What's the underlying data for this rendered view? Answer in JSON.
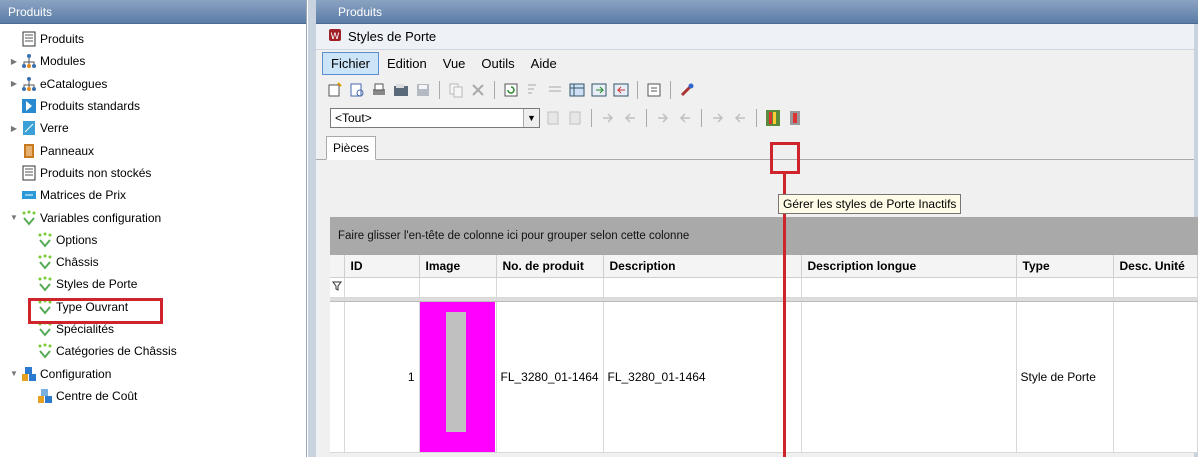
{
  "left_panel": {
    "title": "Produits",
    "tree": [
      {
        "label": "Produits",
        "icon": "document-list-icon",
        "level": 0,
        "arrow": ""
      },
      {
        "label": "Modules",
        "icon": "module-tree-icon",
        "level": 0,
        "arrow": "▶"
      },
      {
        "label": "eCatalogues",
        "icon": "module-tree-icon",
        "level": 0,
        "arrow": "▶"
      },
      {
        "label": "Produits standards",
        "icon": "standard-product-icon",
        "level": 0,
        "arrow": ""
      },
      {
        "label": "Verre",
        "icon": "glass-icon",
        "level": 0,
        "arrow": "▶"
      },
      {
        "label": "Panneaux",
        "icon": "panel-icon",
        "level": 0,
        "arrow": ""
      },
      {
        "label": "Produits non stockés",
        "icon": "document-list-icon",
        "level": 0,
        "arrow": ""
      },
      {
        "label": "Matrices de Prix",
        "icon": "price-matrix-icon",
        "level": 0,
        "arrow": ""
      },
      {
        "label": "Variables configuration",
        "icon": "variable-icon",
        "level": 0,
        "arrow": "▼"
      },
      {
        "label": "Options",
        "icon": "variable-icon",
        "level": 1,
        "arrow": ""
      },
      {
        "label": "Châssis",
        "icon": "variable-icon",
        "level": 1,
        "arrow": ""
      },
      {
        "label": "Styles de Porte",
        "icon": "variable-icon",
        "level": 1,
        "arrow": ""
      },
      {
        "label": "Type Ouvrant",
        "icon": "variable-icon",
        "level": 1,
        "arrow": ""
      },
      {
        "label": "Spécialités",
        "icon": "variable-icon",
        "level": 1,
        "arrow": ""
      },
      {
        "label": "Catégories de Châssis",
        "icon": "variable-icon",
        "level": 1,
        "arrow": ""
      },
      {
        "label": "Configuration",
        "icon": "configuration-icon",
        "level": 0,
        "arrow": "▼"
      },
      {
        "label": "Centre de Coût",
        "icon": "cost-center-icon",
        "level": 1,
        "arrow": ""
      }
    ]
  },
  "right_panel": {
    "title": "Produits",
    "window_title": "Styles de Porte",
    "menu": [
      "Fichier",
      "Edition",
      "Vue",
      "Outils",
      "Aide"
    ],
    "filter_value": "<Tout>",
    "tab_label": "Pièces",
    "tooltip": "Gérer les styles de Porte Inactifs",
    "group_hint": "Faire glisser l'en-tête de colonne ici pour grouper selon cette colonne",
    "columns": [
      "ID",
      "Image",
      "No. de produit",
      "Description",
      "Description longue",
      "Type",
      "Desc. Unité"
    ],
    "rows": [
      {
        "id": "1",
        "product_no": "FL_3280_01-1464",
        "description": "FL_3280_01-1464",
        "long_description": "",
        "type": "Style de Porte",
        "unit_desc": ""
      }
    ]
  },
  "colors": {
    "highlight_red": "#d0242d",
    "image_magenta": "#ff00ff",
    "header_blue": "#5c7ca6"
  }
}
